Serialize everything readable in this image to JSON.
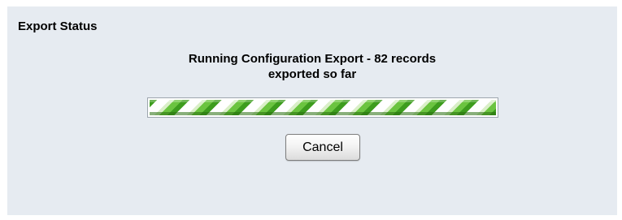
{
  "export_status": {
    "title": "Export Status",
    "message_line1": "Running Configuration Export - 82 records",
    "message_line2": "exported so far",
    "records_exported": 82,
    "progress": {
      "style": "indeterminate-striped",
      "fill_fraction": 1.0,
      "colors": {
        "dark_stripe": "#3d9c1e",
        "light_stripe": "#6bc440",
        "track": "#ffffff",
        "border": "#9da6ae"
      }
    },
    "cancel_label": "Cancel"
  },
  "colors": {
    "panel_background": "#e6ebf1",
    "page_background": "#ffffff"
  }
}
